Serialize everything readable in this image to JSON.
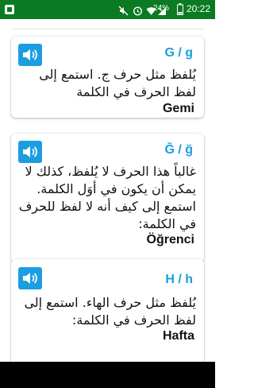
{
  "status_bar": {
    "time": "20:22",
    "battery_percent": "24%",
    "icons": [
      "app-icon",
      "mute-icon",
      "alarm-icon",
      "wifi-icon",
      "signal-icon",
      "battery-icon"
    ],
    "background_color": "#0a7a23"
  },
  "colors": {
    "accent": "#1a9ee0",
    "text": "#111111"
  },
  "cards": [
    {
      "letter": "G / g",
      "description": "يُلفظ مثل حرف ج. استمع إلى لفظ الحرف في الكلمة",
      "example_word": "Gemi",
      "icon": "speaker-icon"
    },
    {
      "letter": "Ğ / ğ",
      "description": "غالباً هذا الحرف لا يُلفظ، كذلك لا يمكن أن يكون في أوَل الكلمة. استمع إلى كيف أنه لا لفظ للحرف في الكلمة:",
      "example_word": "Öğrenci",
      "icon": "speaker-icon"
    },
    {
      "letter": "H / h",
      "description": "يُلفظ مثل حرف الهاء. استمع إلى لفظ الحرف في الكلمة:",
      "example_word": "Hafta",
      "icon": "speaker-icon"
    }
  ]
}
